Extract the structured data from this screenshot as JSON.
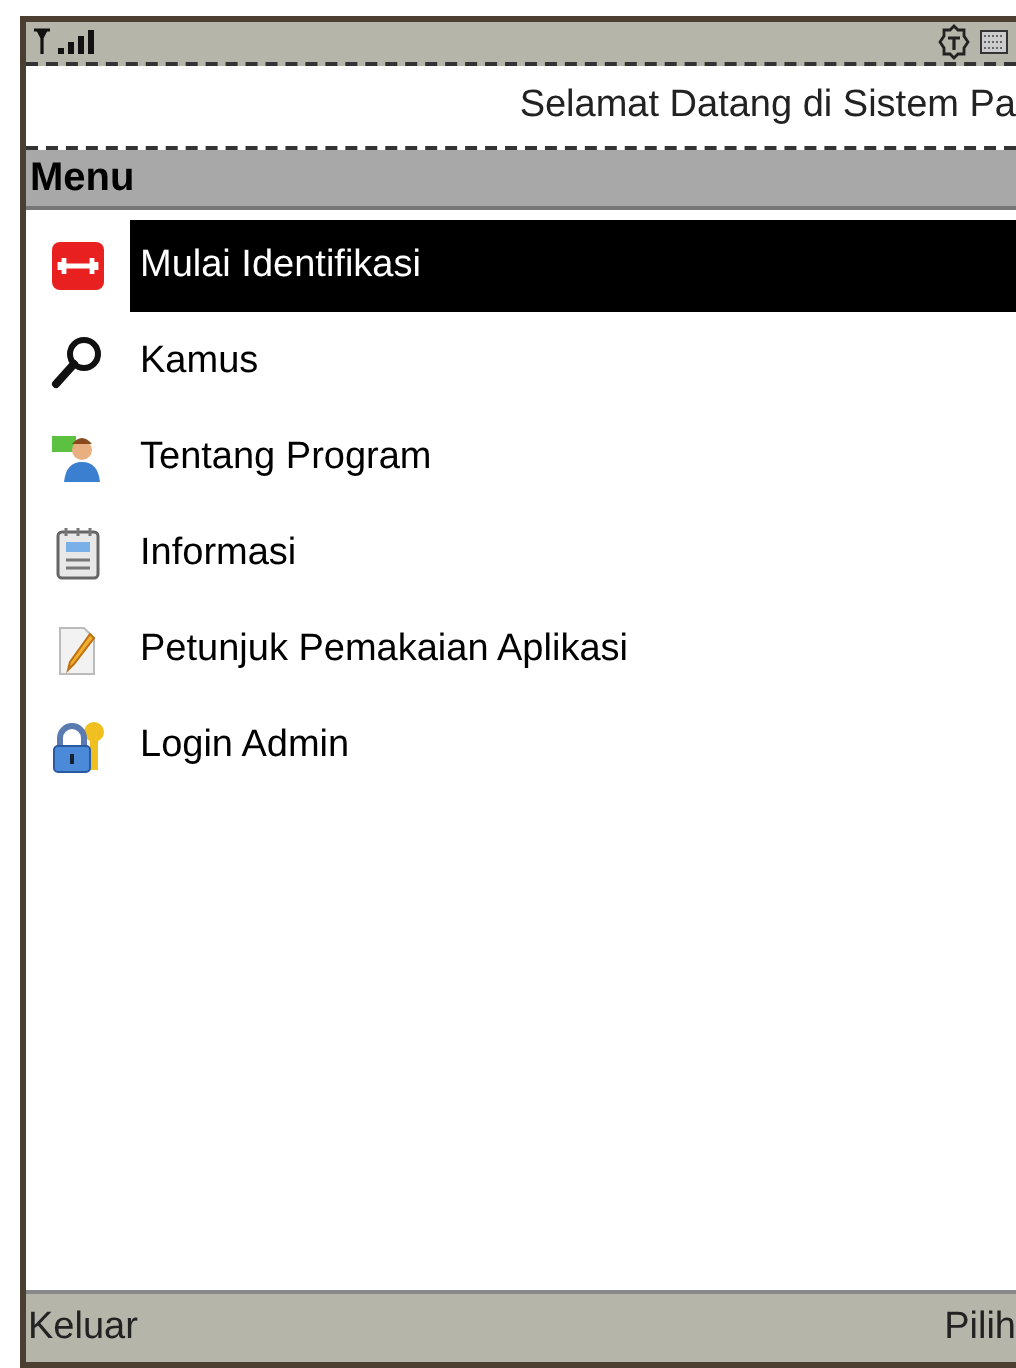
{
  "ticker": "Selamat Datang di Sistem Pa",
  "menu": {
    "title": "Menu",
    "items": [
      {
        "label": "Mulai Identifikasi",
        "selected": true
      },
      {
        "label": "Kamus",
        "selected": false
      },
      {
        "label": "Tentang Program",
        "selected": false
      },
      {
        "label": "Informasi",
        "selected": false
      },
      {
        "label": "Petunjuk Pemakaian Aplikasi",
        "selected": false
      },
      {
        "label": "Login Admin",
        "selected": false
      }
    ]
  },
  "softkeys": {
    "left": "Keluar",
    "right": "Pilih"
  }
}
